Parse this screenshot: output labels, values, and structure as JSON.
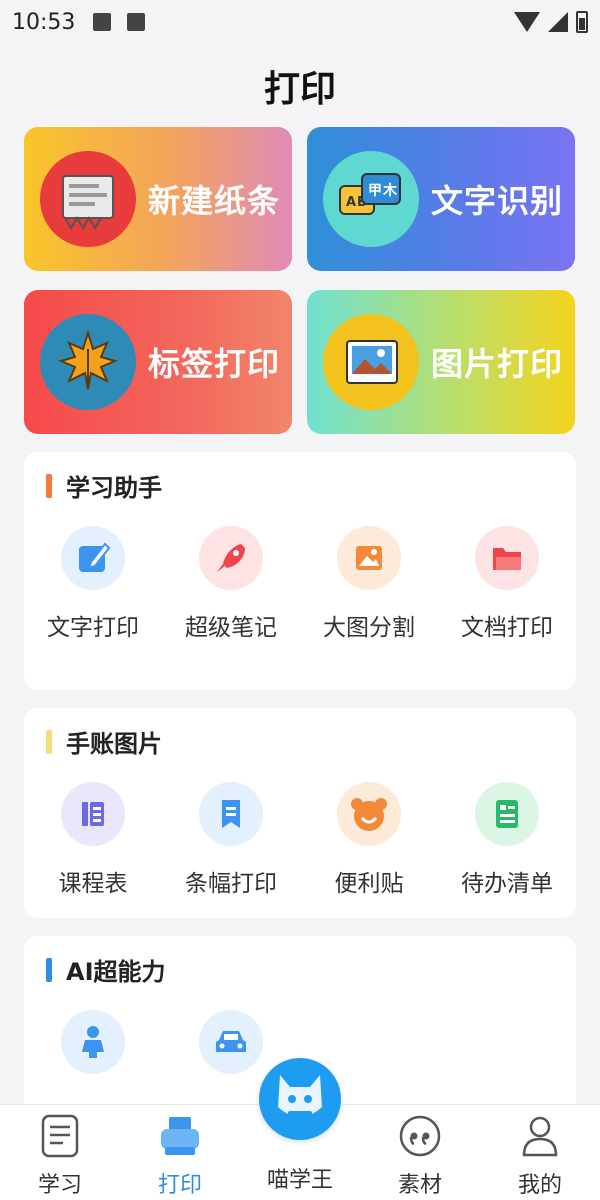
{
  "status_bar": {
    "time": "10:53"
  },
  "header": {
    "title": "打印"
  },
  "cards": [
    {
      "label": "新建纸条",
      "icon": "receipt-paper-icon"
    },
    {
      "label": "文字识别",
      "icon": "translate-bubbles-icon"
    },
    {
      "label": "标签打印",
      "icon": "maple-leaf-icon"
    },
    {
      "label": "图片打印",
      "icon": "landscape-photo-icon"
    }
  ],
  "sections": [
    {
      "title": "学习助手",
      "accent": "#f47a3c",
      "items": [
        {
          "label": "文字打印",
          "icon": "pen-edit-icon"
        },
        {
          "label": "超级笔记",
          "icon": "rocket-icon"
        },
        {
          "label": "大图分割",
          "icon": "image-icon"
        },
        {
          "label": "文档打印",
          "icon": "folder-icon"
        }
      ]
    },
    {
      "title": "手账图片",
      "accent": "#f7dd7a",
      "items": [
        {
          "label": "课程表",
          "icon": "schedule-icon"
        },
        {
          "label": "条幅打印",
          "icon": "banner-bookmark-icon"
        },
        {
          "label": "便利贴",
          "icon": "bear-face-icon"
        },
        {
          "label": "待办清单",
          "icon": "checklist-icon"
        }
      ]
    },
    {
      "title": "AI超能力",
      "accent": "#2e8ee6",
      "items": [
        {
          "label": "",
          "icon": "person-icon"
        },
        {
          "label": "",
          "icon": "car-icon"
        }
      ]
    }
  ],
  "bottom_nav": {
    "items": [
      {
        "label": "学习",
        "icon": "document-icon"
      },
      {
        "label": "打印",
        "icon": "printer-icon",
        "active": true
      },
      {
        "label": "喵学王",
        "icon": "cat-mascot-icon"
      },
      {
        "label": "素材",
        "icon": "quote-icon"
      },
      {
        "label": "我的",
        "icon": "user-icon"
      }
    ]
  },
  "colors": {
    "active_tab": "#2e8ee6",
    "fab": "#1e9cf0"
  }
}
